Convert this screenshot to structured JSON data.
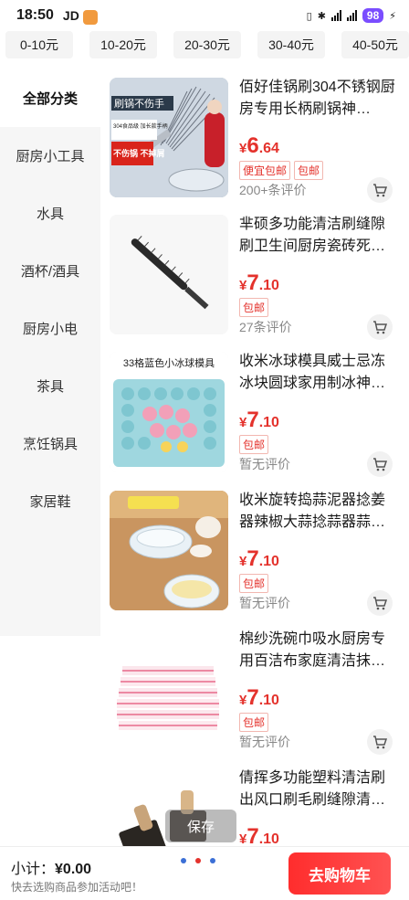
{
  "status_bar": {
    "time": "18:50",
    "app": "JD",
    "battery": "98"
  },
  "price_tabs": [
    "0-10元",
    "10-20元",
    "20-30元",
    "30-40元",
    "40-50元"
  ],
  "sidebar": {
    "items": [
      "全部分类",
      "厨房小工具",
      "水具",
      "酒杯/酒具",
      "厨房小电",
      "茶具",
      "烹饪锅具",
      "家居鞋"
    ],
    "active_index": 0
  },
  "products": [
    {
      "title": "佰好佳锅刷304不锈钢厨房专用长柄刷锅神…",
      "price_yen": "¥",
      "price_int": "6",
      "price_dec": ".64",
      "tags": [
        "便宜包邮",
        "包邮"
      ],
      "reviews": "200+条评价",
      "image_text_top": "刷锅不伤手",
      "image_text_mid": "304食品级 加长款手柄",
      "image_text_bottom": "不伤锅 不掉屑"
    },
    {
      "title": "芈硕多功能清洁刷缝隙刷卫生间厨房瓷砖死…",
      "price_yen": "¥",
      "price_int": "7",
      "price_dec": ".10",
      "tags": [
        "包邮"
      ],
      "reviews": "27条评价"
    },
    {
      "title": "收米冰球模具威士忌冻冰块圆球家用制冰神…",
      "price_yen": "¥",
      "price_int": "7",
      "price_dec": ".10",
      "tags": [
        "包邮"
      ],
      "reviews": "暂无评价",
      "image_caption": "33格蓝色小冰球模具"
    },
    {
      "title": "收米旋转捣蒜泥器捻姜器辣椒大蒜捻蒜器蒜…",
      "price_yen": "¥",
      "price_int": "7",
      "price_dec": ".10",
      "tags": [
        "包邮"
      ],
      "reviews": "暂无评价"
    },
    {
      "title": "棉纱洗碗巾吸水厨房专用百洁布家庭清洁抹…",
      "price_yen": "¥",
      "price_int": "7",
      "price_dec": ".10",
      "tags": [
        "包邮"
      ],
      "reviews": "暂无评价"
    },
    {
      "title": "倩挥多功能塑料清洁刷出风口刷毛刷缝隙清…",
      "price_yen": "¥",
      "price_int": "7",
      "price_dec": ".10",
      "tags": [],
      "reviews": ""
    }
  ],
  "save_overlay": "保存",
  "bottom_bar": {
    "subtotal_label": "小计：",
    "subtotal_amount": "¥0.00",
    "hint": "快去选购商品参加活动吧！",
    "checkout_label": "去购物车"
  },
  "colors": {
    "accent": "#e4322c",
    "dot_colors": [
      "#3b6fd6",
      "#e4322c",
      "#3b6fd6"
    ]
  }
}
